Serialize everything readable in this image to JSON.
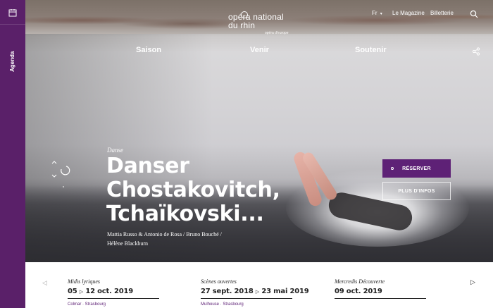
{
  "sidebar": {
    "agenda_label": "Agenda",
    "icon": "calendar-icon"
  },
  "header": {
    "lang": "Fr",
    "links": [
      "Le Magazine",
      "Billetterie"
    ],
    "logo": {
      "line1": "opéra national",
      "line2": "du rhin",
      "tagline": "opéra d'europe"
    }
  },
  "mainnav": [
    "Saison",
    "Venir",
    "Soutenir"
  ],
  "hero": {
    "category": "Danse",
    "title": [
      "Danser",
      "Chostakovitch,",
      "Tchaïkovski..."
    ],
    "credits": [
      "Mattia Russo & Antonio de Rosa / Bruno Bouché /",
      "Hélène Blackburn"
    ],
    "reserve_label": "RÉSERVER",
    "info_label": "PLUS D'INFOS"
  },
  "events": [
    {
      "category": "Midis lyriques",
      "date_start": "05",
      "date_end": "12 oct. 2019",
      "place": "Colmar · Strasbourg"
    },
    {
      "category": "Scènes ouvertes",
      "date_start": "27 sept. 2018",
      "date_end": "23 mai 2019",
      "place": "Mulhouse · Strasbourg"
    },
    {
      "category": "Mercredis Découverte",
      "date_start": "09 oct. 2019",
      "date_end": "",
      "place": ""
    }
  ],
  "colors": {
    "brand_purple": "#5e2176",
    "rail_purple": "#5a2069"
  }
}
